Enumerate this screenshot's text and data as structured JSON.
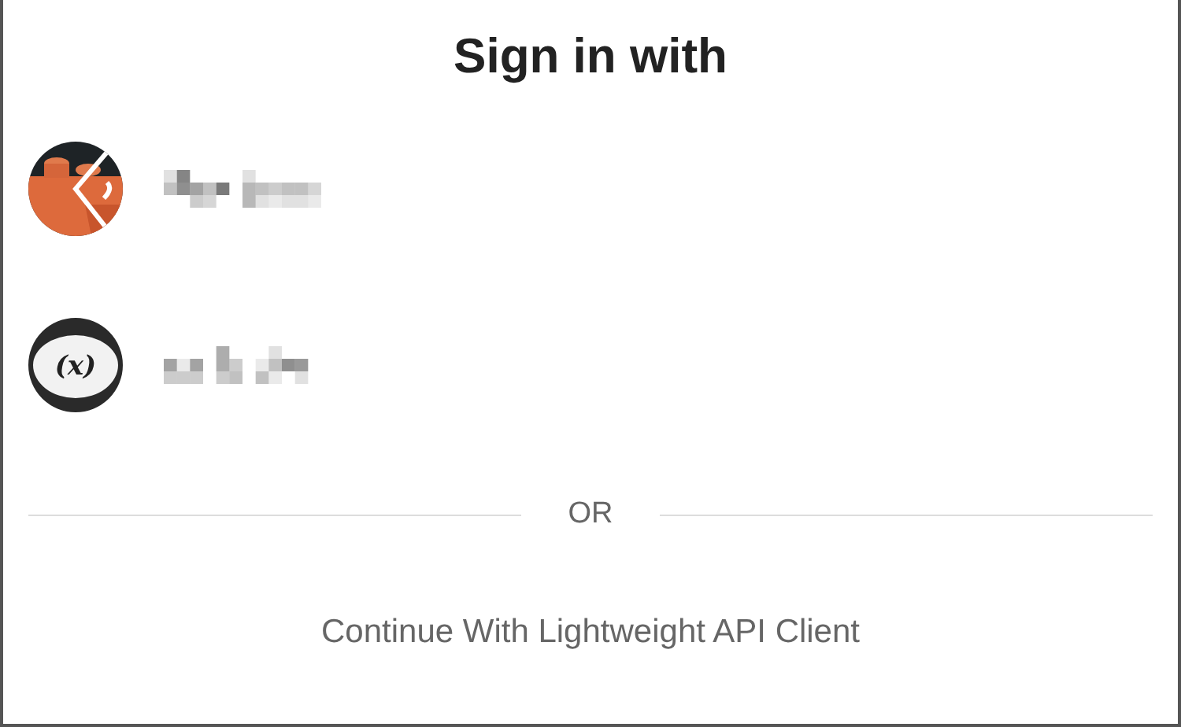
{
  "title": "Sign in with",
  "accounts": [
    {
      "kind": "brick"
    },
    {
      "kind": "text-logo",
      "logo_text": "(x)"
    }
  ],
  "separator": "OR",
  "continue_link": "Continue With Lightweight API Client"
}
